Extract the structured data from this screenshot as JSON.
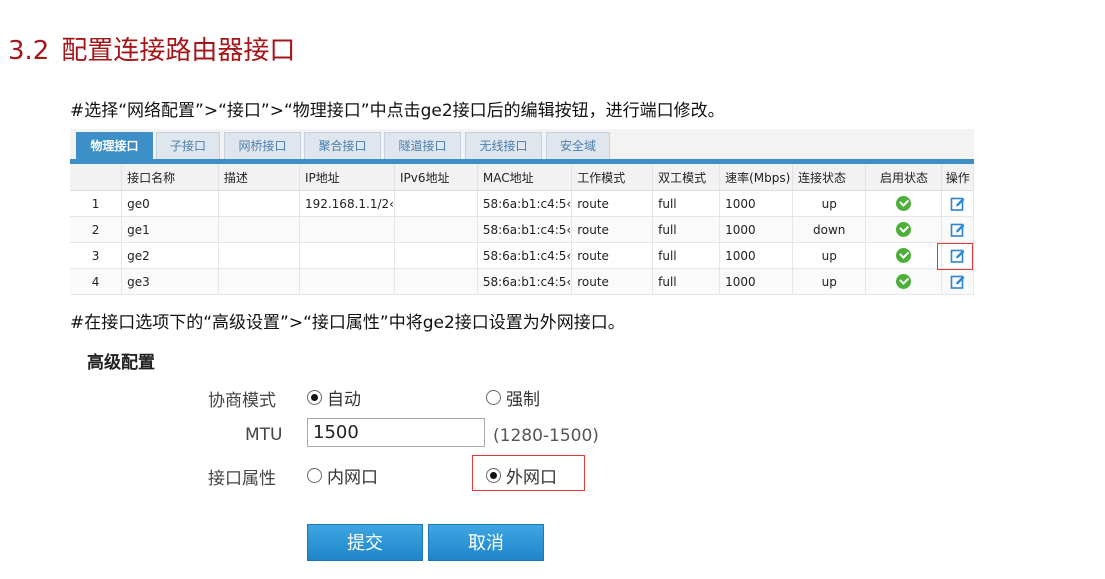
{
  "heading": {
    "number": "3.2",
    "title": "配置连接路由器接口"
  },
  "instructions": [
    "#选择“网络配置”>“接口”>“物理接口”中点击ge2接口后的编辑按钮，进行端口修改。",
    "#在接口选项下的“高级设置”>“接口属性”中将ge2接口设置为外网接口。"
  ],
  "tabs": [
    "物理接口",
    "子接口",
    "网桥接口",
    "聚合接口",
    "隧道接口",
    "无线接口",
    "安全域"
  ],
  "active_tab": "物理接口",
  "table": {
    "columns": [
      "",
      "接口名称",
      "描述",
      "IP地址",
      "IPv6地址",
      "MAC地址",
      "工作模式",
      "双工模式",
      "速率(Mbps)",
      "连接状态",
      "启用状态",
      "操作"
    ],
    "rows": [
      [
        "1",
        "ge0",
        "",
        "192.168.1.1/2‹",
        "",
        "58:6a:b1:c4:5‹",
        "route",
        "full",
        "1000",
        "up"
      ],
      [
        "2",
        "ge1",
        "",
        "",
        "",
        "58:6a:b1:c4:5‹",
        "route",
        "full",
        "1000",
        "down"
      ],
      [
        "3",
        "ge2",
        "",
        "",
        "",
        "58:6a:b1:c4:5‹",
        "route",
        "full",
        "1000",
        "up"
      ],
      [
        "4",
        "ge3",
        "",
        "",
        "",
        "58:6a:b1:c4:5‹",
        "route",
        "full",
        "1000",
        "up"
      ]
    ],
    "enabled_icon": "check-circle-icon",
    "action_icon": "edit-icon"
  },
  "advanced": {
    "title": "高级配置",
    "negotiation_label": "协商模式",
    "negotiation_options": [
      "自动",
      "强制"
    ],
    "negotiation_selected": "自动",
    "mtu_label": "MTU",
    "mtu_value": "1500",
    "mtu_range": "(1280-1500)",
    "attribute_label": "接口属性",
    "attribute_options": [
      "内网口",
      "外网口"
    ],
    "attribute_selected": "外网口"
  },
  "buttons": {
    "submit": "提交",
    "cancel": "取消"
  },
  "colors": {
    "heading": "#a4161a",
    "tab_active": "#3d8fc7",
    "highlight": "#e03a3a",
    "button": "#2d95d8",
    "ok": "#4caf3a"
  }
}
